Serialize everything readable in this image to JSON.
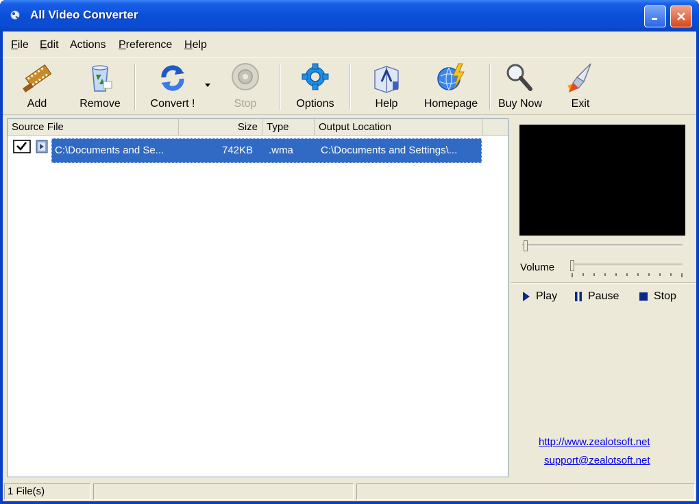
{
  "window": {
    "title": "All Video Converter"
  },
  "menu": [
    {
      "label": "File",
      "ul": "F",
      "rest": "ile"
    },
    {
      "label": "Edit",
      "ul": "E",
      "rest": "dit"
    },
    {
      "label": "Actions",
      "ul": "",
      "rest": "Actions"
    },
    {
      "label": "Preference",
      "ul": "P",
      "rest": "reference"
    },
    {
      "label": "Help",
      "ul": "H",
      "rest": "elp"
    }
  ],
  "toolbar": {
    "add": "Add",
    "remove": "Remove",
    "convert": "Convert !",
    "stop": "Stop",
    "options": "Options",
    "help": "Help",
    "homepage": "Homepage",
    "buy_now": "Buy Now",
    "exit": "Exit"
  },
  "file_list": {
    "columns": [
      "Source File",
      "Size",
      "Type",
      "Output Location"
    ],
    "rows": [
      {
        "checked": true,
        "source": "C:\\Documents and Se...",
        "size": "742KB",
        "type": ".wma",
        "output": "C:\\Documents and Settings\\..."
      }
    ]
  },
  "preview": {
    "volume_label": "Volume",
    "seek_position": 0,
    "volume_level": 0,
    "play": "Play",
    "pause": "Pause",
    "stop": "Stop",
    "website": "http://www.zealotsoft.net",
    "support": "support@zealotsoft.net"
  },
  "status": {
    "files": "1 File(s)",
    "cell2": "",
    "cell3": ""
  },
  "colors": {
    "titlebar": "#0a4fd9",
    "face": "#ece9d8",
    "selection": "#316ac5",
    "link": "#0000ee",
    "player_icons": "#0a2a8c"
  }
}
